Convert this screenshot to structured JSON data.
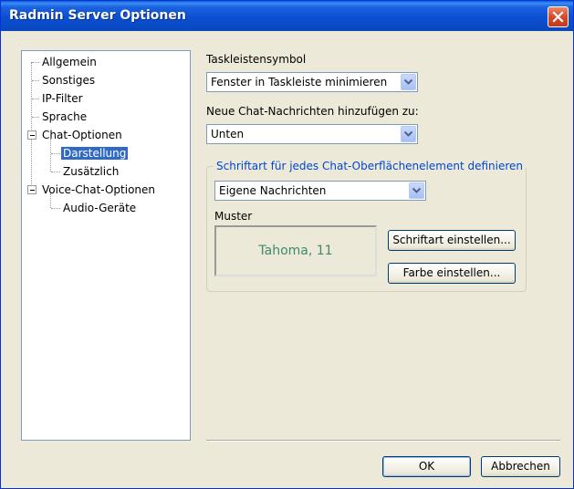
{
  "window": {
    "title": "Radmin Server Optionen"
  },
  "tree": {
    "items": [
      {
        "label": "Allgemein"
      },
      {
        "label": "Sonstiges"
      },
      {
        "label": "IP-Filter"
      },
      {
        "label": "Sprache"
      },
      {
        "label": "Chat-Optionen"
      },
      {
        "label": "Darstellung"
      },
      {
        "label": "Zusätzlich"
      },
      {
        "label": "Voice-Chat-Optionen"
      },
      {
        "label": "Audio-Geräte"
      }
    ],
    "selected": "Darstellung"
  },
  "taskbar": {
    "label": "Taskleistensymbol",
    "value": "Fenster in Taskleiste minimieren"
  },
  "chat_messages": {
    "label": "Neue Chat-Nachrichten hinzufügen zu:",
    "value": "Unten"
  },
  "font_group": {
    "title": "Schriftart für jedes Chat-Oberflächenelement definieren",
    "element_value": "Eigene Nachrichten",
    "sample_label": "Muster",
    "sample_text": "Tahoma, 11",
    "set_font_button": "Schriftart einstellen...",
    "set_color_button": "Farbe einstellen..."
  },
  "buttons": {
    "ok": "OK",
    "cancel": "Abbrechen"
  },
  "colors": {
    "titlebar": "#0b4fd0",
    "selection": "#316ac5",
    "sample_text": "#3c8a6f",
    "group_title": "#0046d5"
  },
  "icons": {
    "close": "close-icon",
    "dropdown": "chevron-down-icon",
    "tree_expander": "minus-box-icon"
  }
}
